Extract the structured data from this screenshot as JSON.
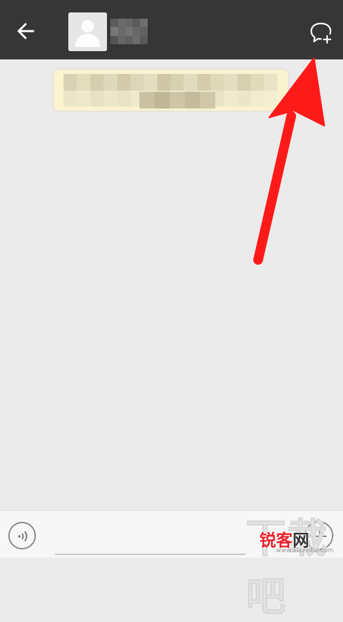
{
  "header": {
    "back_icon": "arrow-left-icon",
    "contact_name_blurred": true,
    "new_chat_icon": "chat-bubble-plus-icon"
  },
  "notice": {
    "blurred": true
  },
  "annotation": {
    "color": "#ff1a1a"
  },
  "composer": {
    "voice_icon": "voice-wave-icon",
    "input_value": "",
    "plus_icon": "plus-icon"
  },
  "watermark": {
    "big_chars": "下载吧",
    "logo_main": "锐客",
    "logo_accent": "网",
    "url": "www.xiazaiba.com"
  },
  "colors": {
    "header_bg": "#363636",
    "chat_bg": "#ebebeb",
    "notice_bg": "#fbf3cf",
    "arrow": "#ff1a1a"
  }
}
